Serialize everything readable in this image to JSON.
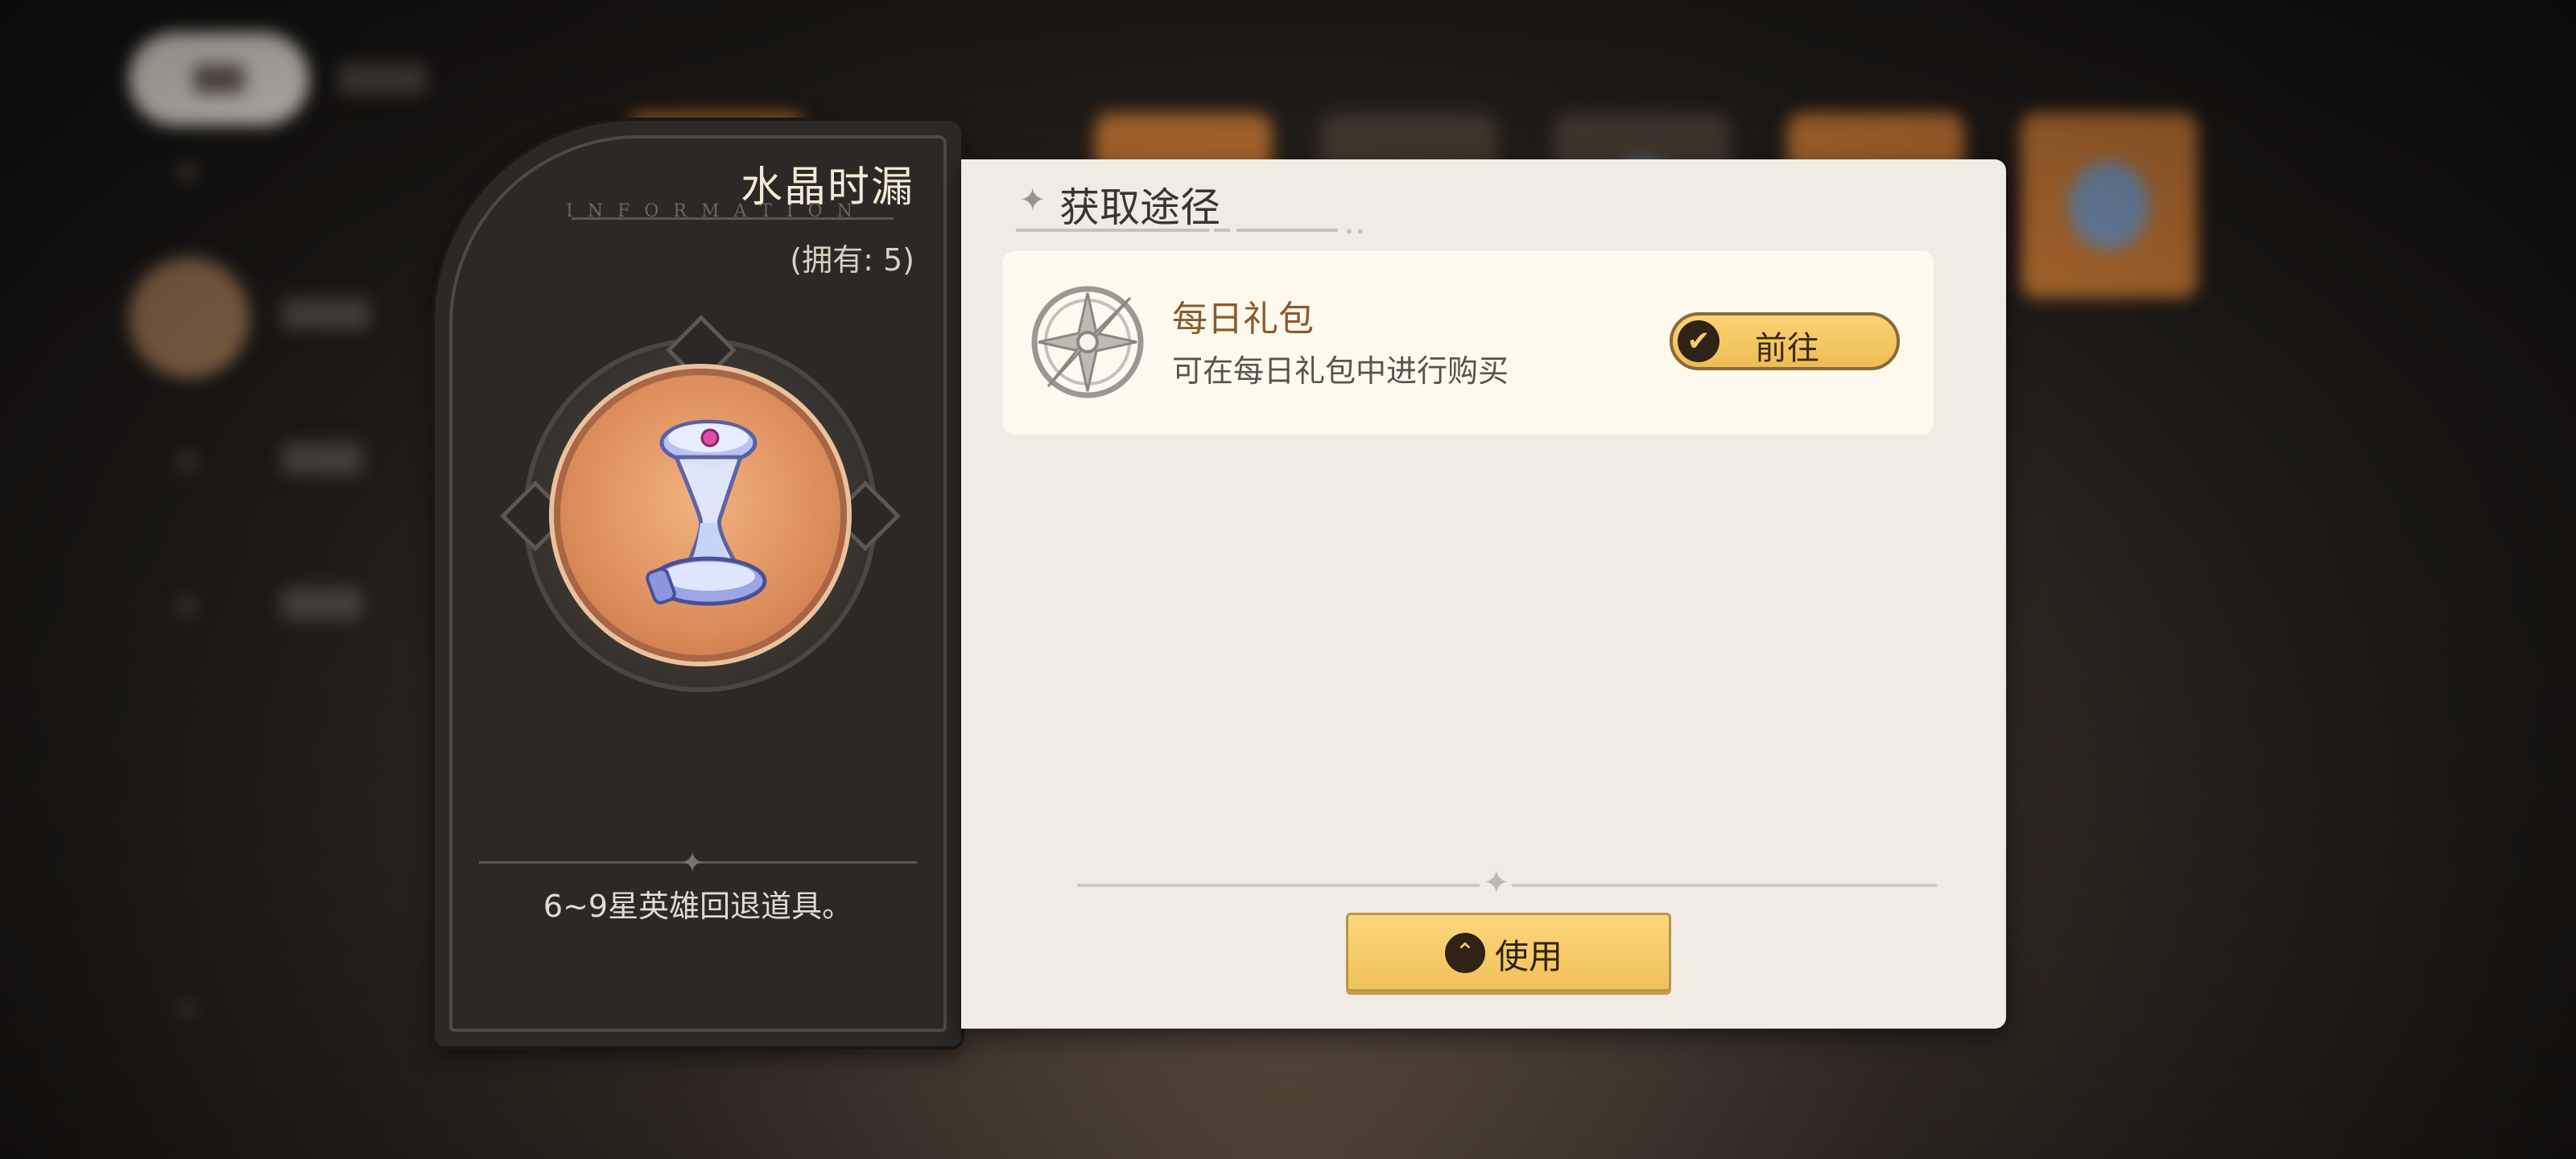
{
  "item": {
    "name": "水晶时漏",
    "watermark": "INFORMATION",
    "owned": "(拥有: 5)",
    "description": "6~9星英雄回退道具。",
    "icon": "crystal-hourglass-icon"
  },
  "acquisition": {
    "title": "获取途径",
    "sources": [
      {
        "name": "每日礼包",
        "description": "可在每日礼包中进行购买",
        "icon": "compass-icon",
        "button_label": "前往"
      }
    ]
  },
  "actions": {
    "use_label": "使用"
  },
  "colors": {
    "accent_gold": "#f2c158",
    "panel_dark": "#2b2826",
    "panel_light": "#f0ece3",
    "source_name": "#8c5a2e"
  }
}
